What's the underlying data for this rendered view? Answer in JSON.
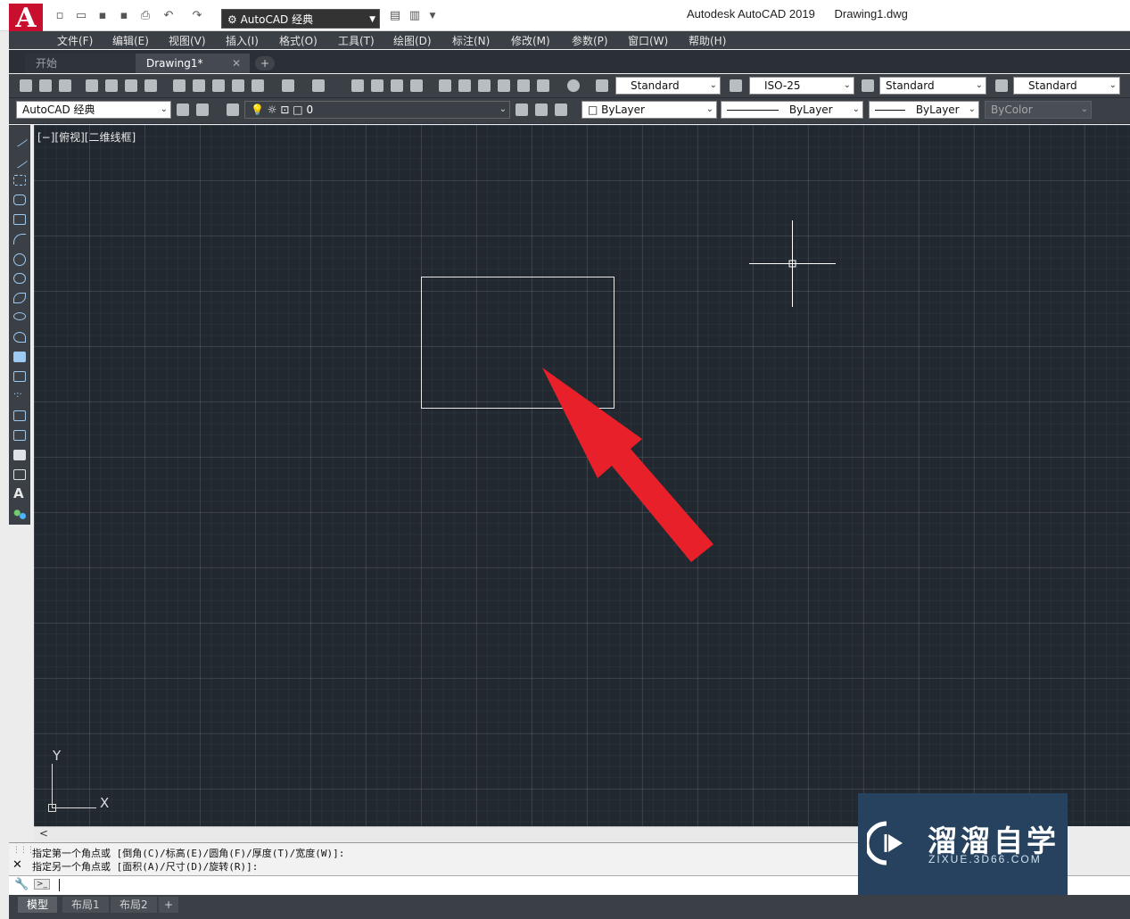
{
  "titlebar": {
    "workspace": "AutoCAD 经典",
    "app_title": "Autodesk AutoCAD 2019",
    "document": "Drawing1.dwg"
  },
  "menu": {
    "items": [
      "文件(F)",
      "编辑(E)",
      "视图(V)",
      "插入(I)",
      "格式(O)",
      "工具(T)",
      "绘图(D)",
      "标注(N)",
      "修改(M)",
      "参数(P)",
      "窗口(W)",
      "帮助(H)"
    ]
  },
  "tabs": {
    "start": "开始",
    "drawing": "Drawing1*",
    "close_glyph": "✕",
    "add_glyph": "+"
  },
  "styles_toolbar": {
    "text_style": "Standard",
    "dim_style": "ISO-25",
    "table_style": "Standard",
    "multileader_style": "Standard"
  },
  "layers_toolbar": {
    "workspace": "AutoCAD 经典",
    "layer": "0",
    "color": "ByLayer",
    "linetype": "ByLayer",
    "lineweight": "ByLayer",
    "plotstyle": "ByColor"
  },
  "viewport": {
    "label": "[−][俯视][二维线框]",
    "ucs_x": "X",
    "ucs_y": "Y"
  },
  "scrollbar": {
    "left_arrow": "<"
  },
  "command": {
    "history": [
      "指定第一个角点或 [倒角(C)/标高(E)/圆角(F)/厚度(T)/宽度(W)]:",
      "指定另一个角点或 [面积(A)/尺寸(D)/旋转(R)]:"
    ],
    "close_glyph": "✕",
    "prompt_icon": ">_"
  },
  "layout_tabs": [
    "模型",
    "布局1",
    "布局2"
  ],
  "layout_add": "+",
  "watermark": {
    "main": "溜溜自学",
    "sub": "ZIXUE.3D66.COM"
  },
  "colors": {
    "accent_red": "#e8202a",
    "canvas": "#212830",
    "chrome": "#3b3f46"
  }
}
